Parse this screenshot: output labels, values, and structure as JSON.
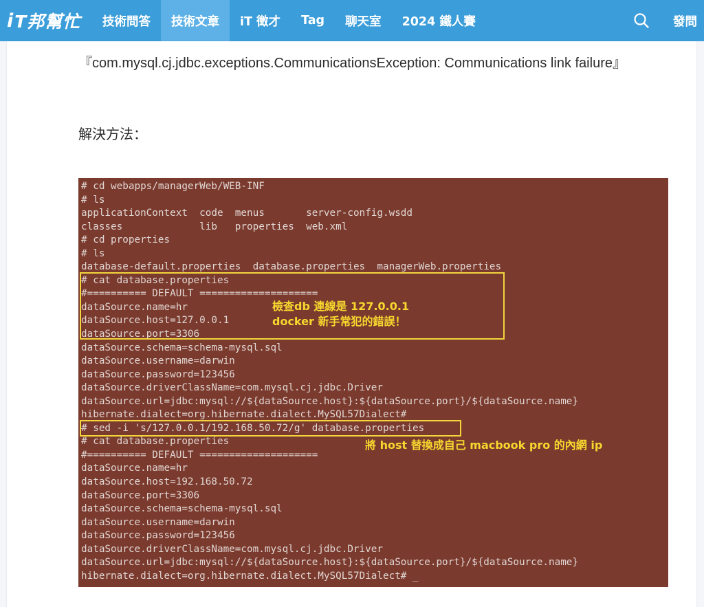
{
  "header": {
    "logo_i": "i",
    "logo_text": "T邦幫忙",
    "nav": [
      "技術問答",
      "技術文章",
      "iT 徵才",
      "Tag",
      "聊天室",
      "2024 鐵人賽"
    ],
    "active_index": 1,
    "search_icon": "search-icon",
    "ask_label": "發問"
  },
  "article": {
    "error_open": "『",
    "error_text": "com.mysql.cj.jdbc.exceptions.CommunicationsException: Communications link failure",
    "error_close": "』",
    "solution_label": "解決方法："
  },
  "terminal": {
    "colors": {
      "background": "#7b3a2e",
      "text": "#e0d6d2",
      "highlight": "#f2d63c"
    },
    "lines": [
      "# cd webapps/managerWeb/WEB-INF",
      "# ls",
      "applicationContext  code  menus       server-config.wsdd",
      "classes             lib   properties  web.xml",
      "# cd properties",
      "# ls",
      "database-default.properties  database.properties  managerWeb.properties",
      "# cat database.properties",
      "#========== DEFAULT ====================",
      "dataSource.name=hr",
      "dataSource.host=127.0.0.1",
      "dataSource.port=3306",
      "dataSource.schema=schema-mysql.sql",
      "dataSource.username=darwin",
      "dataSource.password=123456",
      "dataSource.driverClassName=com.mysql.cj.jdbc.Driver",
      "dataSource.url=jdbc:mysql://${dataSource.host}:${dataSource.port}/${dataSource.name}",
      "hibernate.dialect=org.hibernate.dialect.MySQL57Dialect#",
      "# sed -i 's/127.0.0.1/192.168.50.72/g' database.properties",
      "# cat database.properties",
      "#========== DEFAULT ====================",
      "dataSource.name=hr",
      "dataSource.host=192.168.50.72",
      "dataSource.port=3306",
      "dataSource.schema=schema-mysql.sql",
      "dataSource.username=darwin",
      "dataSource.password=123456",
      "dataSource.driverClassName=com.mysql.cj.jdbc.Driver",
      "dataSource.url=jdbc:mysql://${dataSource.host}:${dataSource.port}/${dataSource.name}",
      "hibernate.dialect=org.hibernate.dialect.MySQL57Dialect# _"
    ],
    "annotation_1": [
      "檢查db 連線是 127.0.0.1",
      "docker 新手常犯的錯誤！"
    ],
    "annotation_2": "將 host 替換成自己 macbook pro 的內網 ip"
  }
}
